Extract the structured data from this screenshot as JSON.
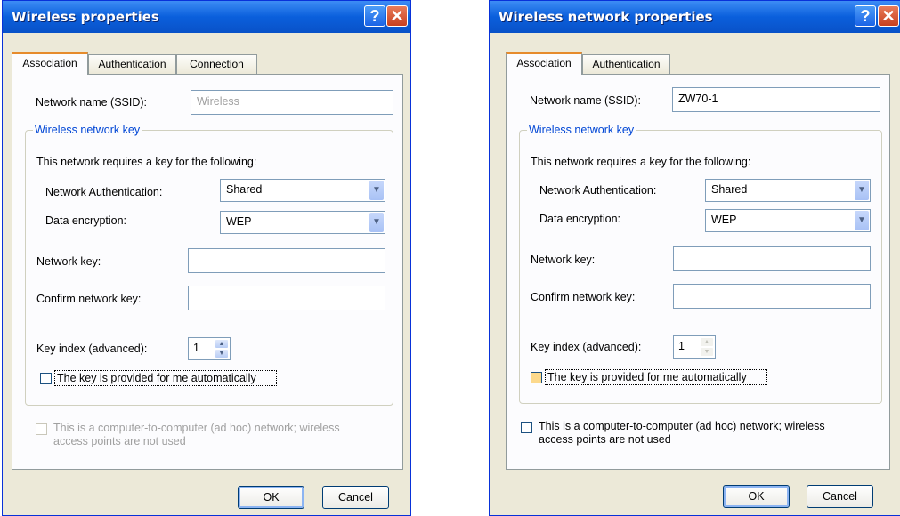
{
  "dialogs": [
    {
      "title": "Wireless properties",
      "tabs": [
        "Association",
        "Authentication",
        "Connection"
      ],
      "network_name_label": "Network name (SSID):",
      "network_name_value": "Wireless",
      "group_title": "Wireless network key",
      "requires_key_text": "This network requires a key for the following:",
      "net_auth_label": "Network Authentication:",
      "net_auth_value": "Shared",
      "data_enc_label": "Data encryption:",
      "data_enc_value": "WEP",
      "network_key_label": "Network key:",
      "confirm_key_label": "Confirm network key:",
      "key_index_label": "Key index (advanced):",
      "key_index_value": "1",
      "auto_key_label": "The key is provided for me automatically",
      "adhoc_line1": "This is a computer-to-computer (ad hoc) network; wireless",
      "adhoc_line2": "access points are not used",
      "ok_label": "OK",
      "cancel_label": "Cancel"
    },
    {
      "title": "Wireless network properties",
      "tabs": [
        "Association",
        "Authentication"
      ],
      "network_name_label": "Network name (SSID):",
      "network_name_value": "ZW70-1",
      "group_title": "Wireless network key",
      "requires_key_text": "This network requires a key for the following:",
      "net_auth_label": "Network Authentication:",
      "net_auth_value": "Shared",
      "data_enc_label": "Data encryption:",
      "data_enc_value": "WEP",
      "network_key_label": "Network key:",
      "confirm_key_label": "Confirm network key:",
      "key_index_label": "Key index (advanced):",
      "key_index_value": "1",
      "auto_key_label": "The key is provided for me automatically",
      "adhoc_line1": "This is a computer-to-computer (ad hoc) network; wireless",
      "adhoc_line2": "access points are not used",
      "ok_label": "OK",
      "cancel_label": "Cancel"
    }
  ],
  "icons": {
    "help": "help-icon",
    "close": "close-icon",
    "dropdown": "chevron-down-icon"
  },
  "colors": {
    "title_bar": "#0a5fdc",
    "dialog_bg": "#ece9d8",
    "group_title": "#0046d5",
    "close_button": "#c8401f",
    "tab_highlight": "#e68b2c"
  }
}
